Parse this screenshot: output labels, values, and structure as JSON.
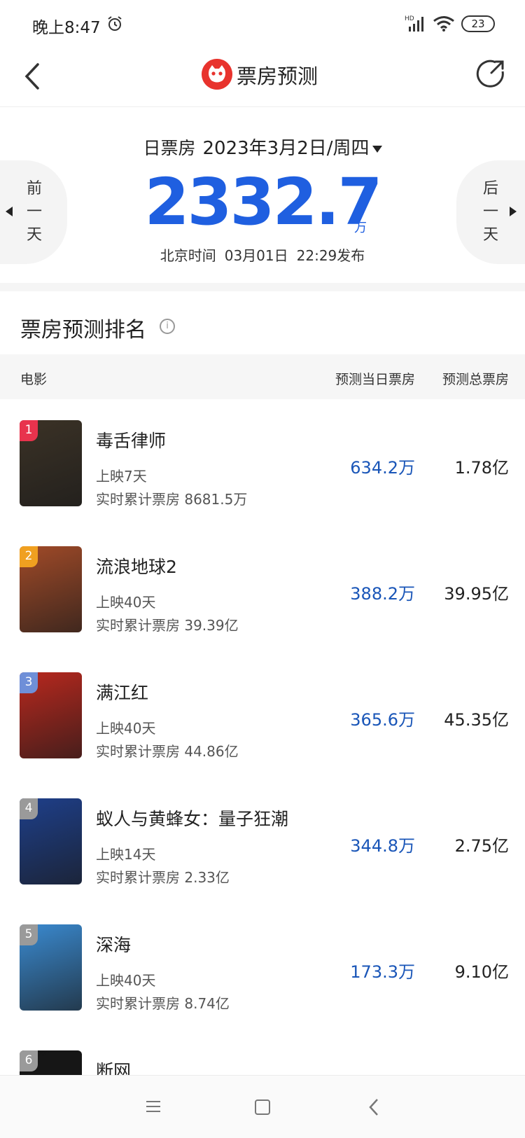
{
  "status_bar": {
    "time": "晚上8:47",
    "signal_label": "HD",
    "battery": "23"
  },
  "nav": {
    "title": "票房预测"
  },
  "hero": {
    "date_label": "日票房",
    "date_value": "2023年3月2日/周四",
    "box_office": "2332.7",
    "unit": "万",
    "publish_prefix": "北京时间",
    "publish_date": "03月01日",
    "publish_time": "22:29发布",
    "prev_label": [
      "前",
      "一",
      "天"
    ],
    "next_label": [
      "后",
      "一",
      "天"
    ]
  },
  "section": {
    "title": "票房预测排名",
    "info": "i"
  },
  "table": {
    "col_movie": "电影",
    "col_day": "预测当日票房",
    "col_total": "预测总票房",
    "rows": [
      {
        "rank": "1",
        "title": "毒舌律师",
        "days": "上映7天",
        "cumulative": "实时累计票房 8681.5万",
        "day_box": "634.2万",
        "total_box": "1.78亿",
        "badge_color": "#e8334d",
        "poster_color": "#3b3226"
      },
      {
        "rank": "2",
        "title": "流浪地球2",
        "days": "上映40天",
        "cumulative": "实时累计票房 39.39亿",
        "day_box": "388.2万",
        "total_box": "39.95亿",
        "badge_color": "#f0a020",
        "poster_color": "#a04a28"
      },
      {
        "rank": "3",
        "title": "满江红",
        "days": "上映40天",
        "cumulative": "实时累计票房 44.86亿",
        "day_box": "365.6万",
        "total_box": "45.35亿",
        "badge_color": "#6f8fd8",
        "poster_color": "#b8281e"
      },
      {
        "rank": "4",
        "title": "蚁人与黄蜂女：量子狂潮",
        "days": "上映14天",
        "cumulative": "实时累计票房 2.33亿",
        "day_box": "344.8万",
        "total_box": "2.75亿",
        "badge_color": "#9a9a9a",
        "poster_color": "#1e3f8a"
      },
      {
        "rank": "5",
        "title": "深海",
        "days": "上映40天",
        "cumulative": "实时累计票房 8.74亿",
        "day_box": "173.3万",
        "total_box": "9.10亿",
        "badge_color": "#9a9a9a",
        "poster_color": "#3a8ad0"
      },
      {
        "rank": "6",
        "title": "断网",
        "days": "",
        "cumulative": "",
        "day_box": "",
        "total_box": "",
        "badge_color": "#9a9a9a",
        "poster_color": "#151515"
      }
    ]
  }
}
